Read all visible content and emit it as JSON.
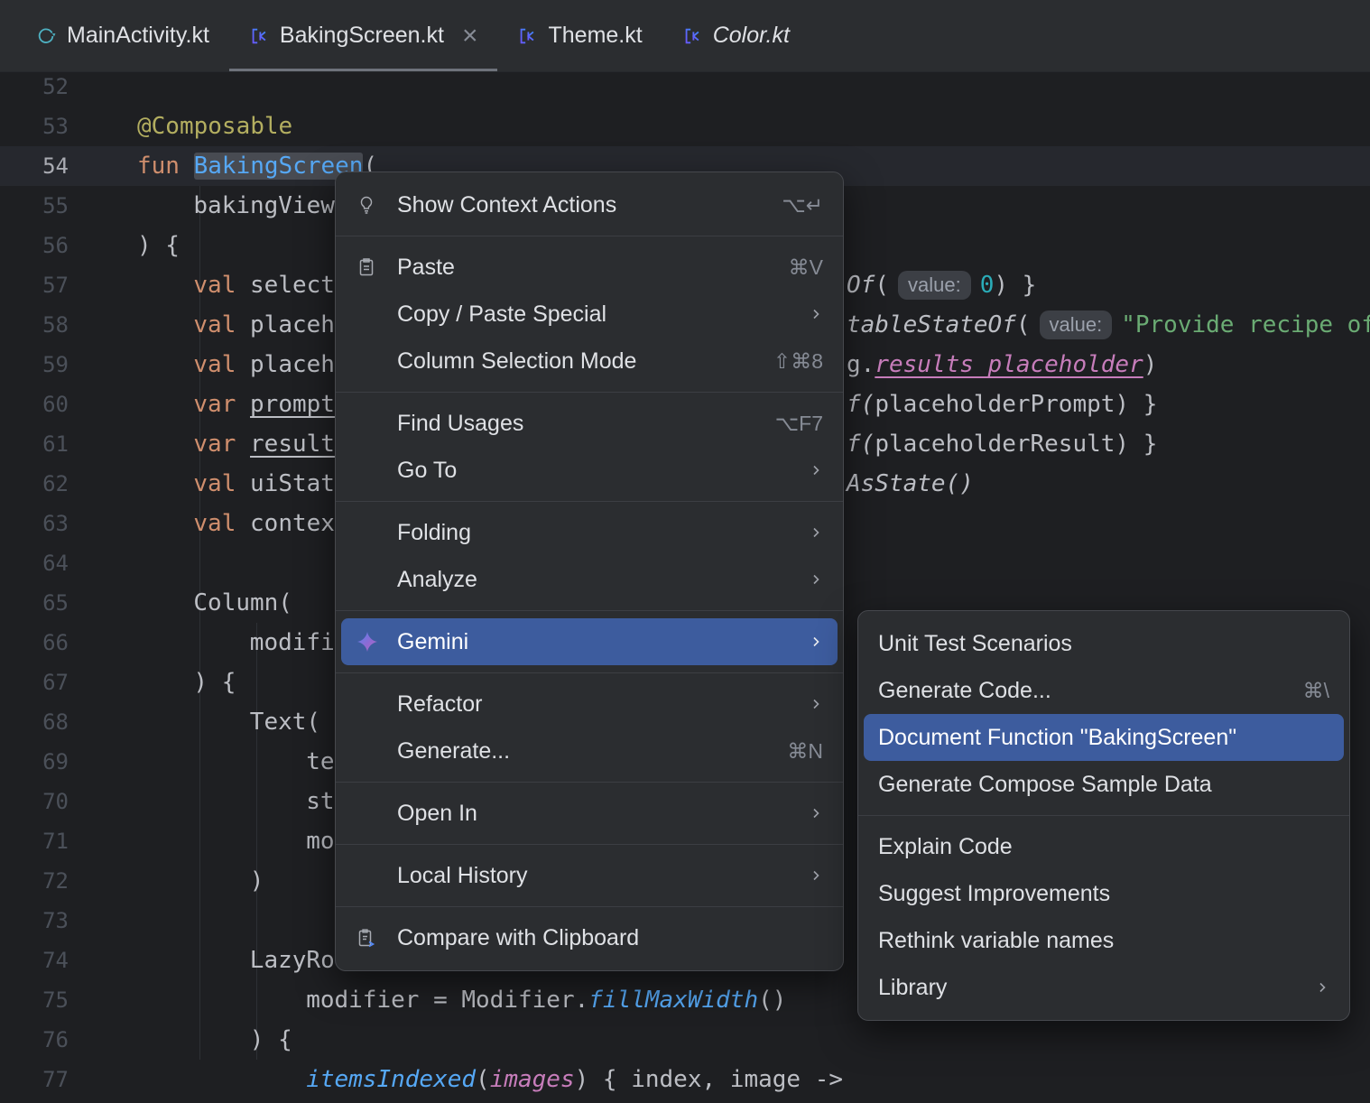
{
  "colors": {
    "editor_bg": "#1e1f22",
    "panel_bg": "#2b2d30",
    "selection_blue": "#3d5c9e",
    "keyword_orange": "#cf8e6d",
    "function_blue": "#56a8f5",
    "string_green": "#6aab73",
    "number_teal": "#2aacb8",
    "annotation_yellow": "#b3ae60",
    "field_purple": "#c77dbb"
  },
  "tab_bar": {
    "tabs": [
      {
        "label": "MainActivity.kt",
        "icon": "compose-file-icon",
        "active": false,
        "italic": false,
        "closable": false
      },
      {
        "label": "BakingScreen.kt",
        "icon": "kotlin-file-icon",
        "active": true,
        "italic": false,
        "closable": true
      },
      {
        "label": "Theme.kt",
        "icon": "kotlin-file-icon",
        "active": false,
        "italic": false,
        "closable": false
      },
      {
        "label": "Color.kt",
        "icon": "kotlin-file-icon",
        "active": false,
        "italic": true,
        "closable": false
      }
    ],
    "close_glyph": "×"
  },
  "editor": {
    "lines": [
      {
        "num": 52,
        "ind": 0,
        "seg": []
      },
      {
        "num": 53,
        "ind": 0,
        "seg": [
          {
            "t": "@Composable",
            "c": "ann"
          }
        ]
      },
      {
        "num": 54,
        "ind": 0,
        "current": true,
        "seg": [
          {
            "t": "fun ",
            "c": "kw"
          },
          {
            "t": "BakingScreen",
            "c": "fn",
            "sel": true
          },
          {
            "t": "(",
            "c": "def"
          }
        ]
      },
      {
        "num": 55,
        "ind": 4,
        "seg": [
          {
            "t": "bakingView",
            "c": "def"
          }
        ]
      },
      {
        "num": 56,
        "ind": 0,
        "seg": [
          {
            "t": ") {",
            "c": "def"
          }
        ]
      },
      {
        "num": 57,
        "ind": 4,
        "seg": [
          {
            "t": "val ",
            "c": "kw"
          },
          {
            "t": "select",
            "c": "def"
          }
        ],
        "rseg": [
          {
            "t": "Of",
            "c": "it"
          },
          {
            "t": "(",
            "c": "def"
          },
          {
            "t": "value:",
            "c": "hint"
          },
          {
            "t": "0",
            "c": "num"
          },
          {
            "t": ") }",
            "c": "def"
          }
        ]
      },
      {
        "num": 58,
        "ind": 4,
        "seg": [
          {
            "t": "val ",
            "c": "kw"
          },
          {
            "t": "placeh",
            "c": "def"
          }
        ],
        "rseg": [
          {
            "t": "tableStateOf",
            "c": "it"
          },
          {
            "t": "(",
            "c": "def"
          },
          {
            "t": "value:",
            "c": "hint"
          },
          {
            "t": "\"Provide recipe of",
            "c": "str"
          }
        ]
      },
      {
        "num": 59,
        "ind": 4,
        "seg": [
          {
            "t": "val ",
            "c": "kw"
          },
          {
            "t": "placeh",
            "c": "def"
          }
        ],
        "rseg": [
          {
            "t": "g.",
            "c": "def"
          },
          {
            "t": "results_placeholder",
            "c": "purx"
          },
          {
            "t": ")",
            "c": "def"
          }
        ]
      },
      {
        "num": 60,
        "ind": 4,
        "seg": [
          {
            "t": "var ",
            "c": "kw"
          },
          {
            "t": "prompt",
            "c": "defu"
          }
        ],
        "rseg": [
          {
            "t": "f(",
            "c": "it"
          },
          {
            "t": "placeholderPrompt",
            "c": "def"
          },
          {
            "t": ") }",
            "c": "def"
          }
        ]
      },
      {
        "num": 61,
        "ind": 4,
        "seg": [
          {
            "t": "var ",
            "c": "kw"
          },
          {
            "t": "result",
            "c": "defu"
          }
        ],
        "rseg": [
          {
            "t": "f(",
            "c": "it"
          },
          {
            "t": "placeholderResult",
            "c": "def"
          },
          {
            "t": ") }",
            "c": "def"
          }
        ]
      },
      {
        "num": 62,
        "ind": 4,
        "seg": [
          {
            "t": "val ",
            "c": "kw"
          },
          {
            "t": "uiStat",
            "c": "def"
          }
        ],
        "rseg": [
          {
            "t": "AsState()",
            "c": "it"
          }
        ]
      },
      {
        "num": 63,
        "ind": 4,
        "seg": [
          {
            "t": "val ",
            "c": "kw"
          },
          {
            "t": "contex",
            "c": "def"
          }
        ]
      },
      {
        "num": 64,
        "ind": 0,
        "seg": []
      },
      {
        "num": 65,
        "ind": 4,
        "seg": [
          {
            "t": "Column(",
            "c": "def"
          }
        ]
      },
      {
        "num": 66,
        "ind": 8,
        "seg": [
          {
            "t": "modifi",
            "c": "def"
          }
        ]
      },
      {
        "num": 67,
        "ind": 4,
        "seg": [
          {
            "t": ") {",
            "c": "def"
          }
        ]
      },
      {
        "num": 68,
        "ind": 8,
        "seg": [
          {
            "t": "Text(",
            "c": "def"
          }
        ]
      },
      {
        "num": 69,
        "ind": 12,
        "seg": [
          {
            "t": "te",
            "c": "def"
          }
        ]
      },
      {
        "num": 70,
        "ind": 12,
        "seg": [
          {
            "t": "st",
            "c": "def"
          }
        ]
      },
      {
        "num": 71,
        "ind": 12,
        "seg": [
          {
            "t": "mo",
            "c": "def"
          }
        ]
      },
      {
        "num": 72,
        "ind": 8,
        "seg": [
          {
            "t": ")",
            "c": "def"
          }
        ]
      },
      {
        "num": 73,
        "ind": 0,
        "seg": []
      },
      {
        "num": 74,
        "ind": 8,
        "seg": [
          {
            "t": "LazyRo",
            "c": "def"
          }
        ]
      },
      {
        "num": 75,
        "ind": 12,
        "seg": [
          {
            "t": "modifier = Modifier.",
            "c": "def"
          },
          {
            "t": "fillMaxWidth",
            "c": "ext"
          },
          {
            "t": "()",
            "c": "def"
          }
        ]
      },
      {
        "num": 76,
        "ind": 8,
        "seg": [
          {
            "t": ") {",
            "c": "def"
          }
        ]
      },
      {
        "num": 77,
        "ind": 12,
        "seg": [
          {
            "t": "itemsIndexed",
            "c": "ext"
          },
          {
            "t": "(",
            "c": "def"
          },
          {
            "t": "images",
            "c": "pur"
          },
          {
            "t": ") { index, image ->",
            "c": "def"
          }
        ]
      }
    ]
  },
  "context_menu": {
    "items": [
      {
        "label": "Show Context Actions",
        "icon": "lightbulb-icon",
        "shortcut": "⌥↵"
      },
      {
        "type": "separator"
      },
      {
        "label": "Paste",
        "icon": "clipboard-paste-icon",
        "shortcut": "⌘V"
      },
      {
        "label": "Copy / Paste Special",
        "submenu": true
      },
      {
        "label": "Column Selection Mode",
        "shortcut": "⇧⌘8"
      },
      {
        "type": "separator"
      },
      {
        "label": "Find Usages",
        "shortcut": "⌥F7"
      },
      {
        "label": "Go To",
        "submenu": true
      },
      {
        "type": "separator"
      },
      {
        "label": "Folding",
        "submenu": true
      },
      {
        "label": "Analyze",
        "submenu": true
      },
      {
        "type": "separator"
      },
      {
        "label": "Gemini",
        "icon": "gemini-spark-icon",
        "submenu": true,
        "selected": true
      },
      {
        "type": "separator"
      },
      {
        "label": "Refactor",
        "submenu": true
      },
      {
        "label": "Generate...",
        "shortcut": "⌘N"
      },
      {
        "type": "separator"
      },
      {
        "label": "Open In",
        "submenu": true
      },
      {
        "type": "separator"
      },
      {
        "label": "Local History",
        "submenu": true
      },
      {
        "type": "separator"
      },
      {
        "label": "Compare with Clipboard",
        "icon": "compare-clipboard-icon"
      }
    ]
  },
  "gemini_submenu": {
    "items": [
      {
        "label": "Unit Test Scenarios"
      },
      {
        "label": "Generate Code...",
        "shortcut": "⌘\\"
      },
      {
        "label": "Document Function \"BakingScreen\"",
        "selected": true
      },
      {
        "label": "Generate Compose Sample Data"
      },
      {
        "type": "separator"
      },
      {
        "label": "Explain Code"
      },
      {
        "label": "Suggest Improvements"
      },
      {
        "label": "Rethink variable names"
      },
      {
        "label": "Library",
        "submenu": true
      }
    ]
  }
}
